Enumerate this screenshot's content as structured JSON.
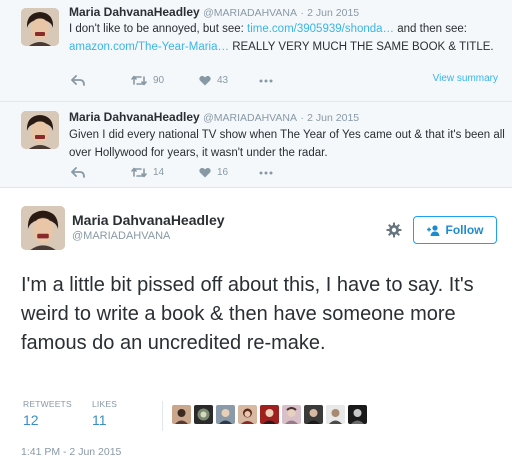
{
  "reply1": {
    "name": "Maria DahvanaHeadley",
    "handle": "@MARIADAHVANA",
    "dot": "·",
    "date": "2 Jun 2015",
    "text_a": "I don't like to be annoyed, but see: ",
    "link_a": "time.com/3905939/shonda…",
    "text_b": " and then see: ",
    "link_b": "amazon.com/The-Year-Maria…",
    "text_c": " REALLY VERY MUCH THE SAME BOOK & TITLE.",
    "retweets": "90",
    "likes": "43",
    "view_summary": "View summary"
  },
  "reply2": {
    "name": "Maria DahvanaHeadley",
    "handle": "@MARIADAHVANA",
    "dot": "·",
    "date": "2 Jun 2015",
    "text": "Given I did every national TV show when The Year of Yes came out & that it's been all over Hollywood for years, it wasn't under the radar.",
    "retweets": "14",
    "likes": "16"
  },
  "main": {
    "name": "Maria DahvanaHeadley",
    "handle": "@MARIADAHVANA",
    "follow_label": "Follow",
    "text": "I'm a little bit pissed off about this, I have to say. It's weird to write a book & then have someone more famous do an uncredited re-make.",
    "retweets_label": "RETWEETS",
    "retweets": "12",
    "likes_label": "LIKES",
    "likes": "11",
    "timestamp": "1:41 PM - 2 Jun 2015"
  },
  "icons": [
    "reply-icon",
    "retweet-icon",
    "heart-icon",
    "more-icon",
    "gear-icon",
    "follow-person-icon"
  ],
  "colors": {
    "link": "#3bb4e9",
    "follow_border": "#1da1f2",
    "stat_value": "#3a8ec6",
    "muted": "#8899a6",
    "reply_bg": "#f5f8fa"
  }
}
